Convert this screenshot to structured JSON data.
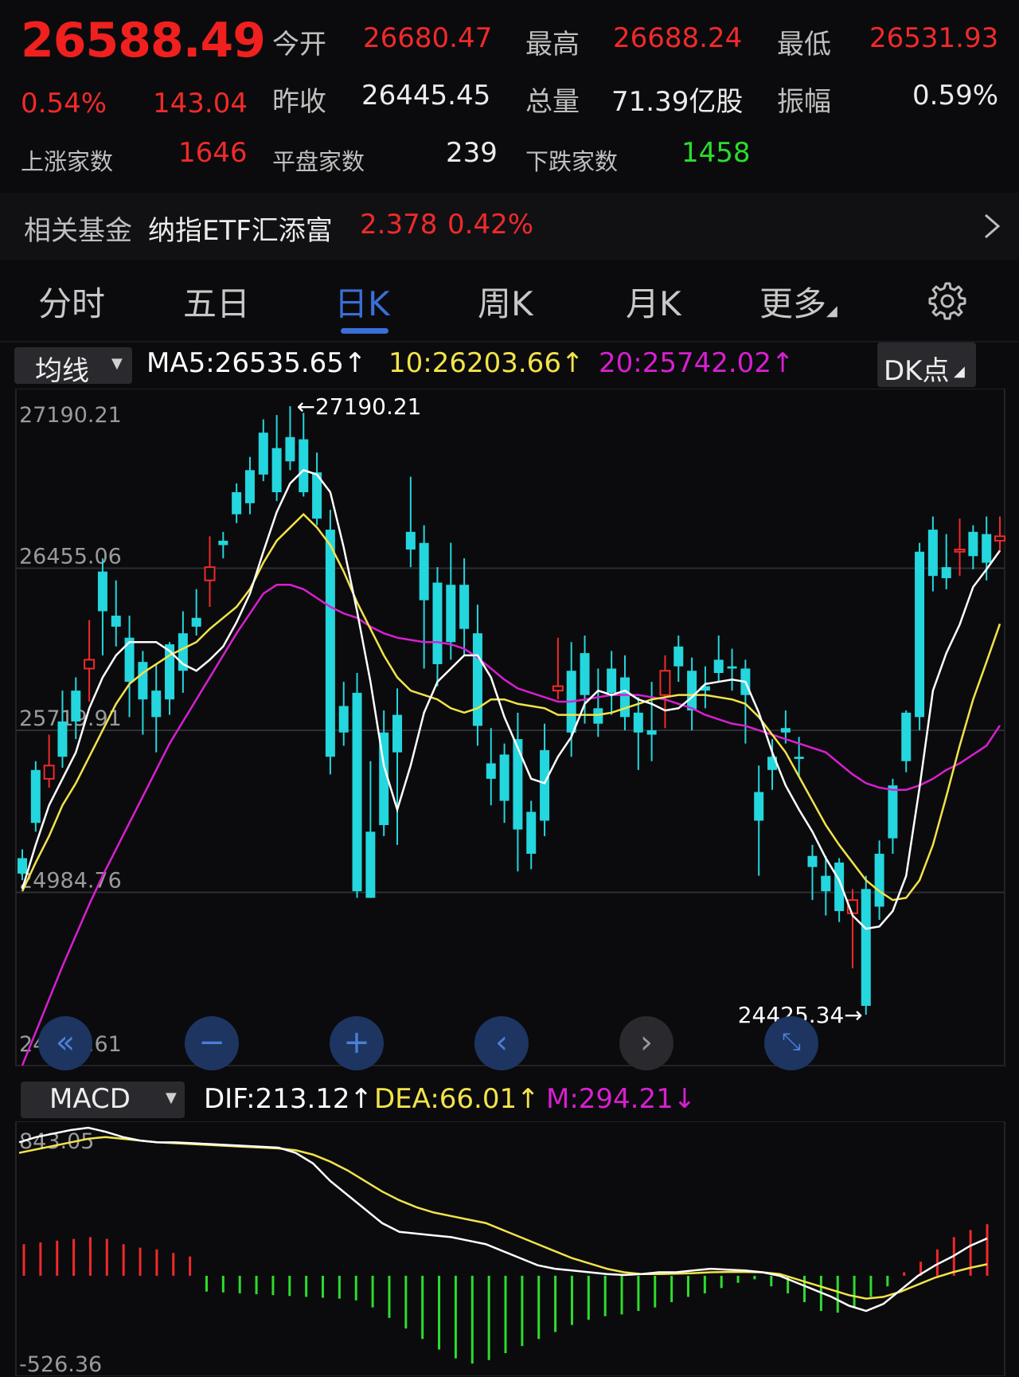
{
  "quote": {
    "price": "26588.49",
    "change_pct": "0.54%",
    "change_val": "143.04",
    "open_label": "今开",
    "open": "26680.47",
    "high_label": "最高",
    "high": "26688.24",
    "low_label": "最低",
    "low": "26531.93",
    "prev_close_label": "昨收",
    "prev_close": "26445.45",
    "volume_label": "总量",
    "volume": "71.39亿股",
    "amplitude_label": "振幅",
    "amplitude": "0.59%",
    "up_label": "上涨家数",
    "up_count": "1646",
    "flat_label": "平盘家数",
    "flat_count": "239",
    "down_label": "下跌家数",
    "down_count": "1458"
  },
  "fund": {
    "label": "相关基金",
    "name": "纳指ETF汇添富",
    "price": "2.378",
    "change": "0.42%"
  },
  "tabs": [
    "分时",
    "五日",
    "日K",
    "周K",
    "月K",
    "更多"
  ],
  "active_tab": 2,
  "indicator": {
    "select_label": "均线",
    "ma5": "MA5:26535.65↑",
    "ma10": "10:26203.66↑",
    "ma20": "20:25742.02↑",
    "dk_label": "DK点"
  },
  "macd": {
    "select_label": "MACD",
    "dif": "DIF:213.12↑",
    "dea": "DEA:66.01↑",
    "m": "M:294.21↓"
  },
  "colors": {
    "up": "#f02a2a",
    "down": "#24d6de",
    "ma5": "#ffffff",
    "ma10": "#f2e34a",
    "ma20": "#d81fd0",
    "accent": "#3a6fd8",
    "macd_pos": "#f02a2a",
    "macd_neg": "#2ddc2d"
  },
  "nav_icons": [
    "fast-back-icon",
    "zoom-out-icon",
    "zoom-in-icon",
    "prev-icon",
    "next-icon",
    "crosshair-icon"
  ],
  "chart_data": [
    {
      "type": "candlestick",
      "y_ticks": [
        "27190.21",
        "26455.06",
        "25719.91",
        "24984.76",
        "24249.61"
      ],
      "ylim": [
        24249.61,
        27190.21
      ],
      "annotations": {
        "max": "←27190.21",
        "min": "24425.34→"
      },
      "candles": [
        [
          25140,
          25070,
          25180,
          25040
        ],
        [
          25540,
          25300,
          25580,
          25260
        ],
        [
          25500,
          25560,
          25700,
          25460
        ],
        [
          25760,
          25600,
          25900,
          25550
        ],
        [
          25900,
          25760,
          25960,
          25680
        ],
        [
          26000,
          26040,
          26220,
          25850
        ],
        [
          26440,
          26260,
          26500,
          26060
        ],
        [
          26240,
          26190,
          26400,
          26100
        ],
        [
          26140,
          25940,
          26240,
          25780
        ],
        [
          26030,
          25860,
          26080,
          25700
        ],
        [
          25900,
          25780,
          26020,
          25620
        ],
        [
          26110,
          25860,
          26120,
          25790
        ],
        [
          26160,
          25990,
          26260,
          25890
        ],
        [
          26230,
          26190,
          26360,
          26150
        ],
        [
          26400,
          26460,
          26600,
          26280
        ],
        [
          26580,
          26560,
          26620,
          26500
        ],
        [
          26800,
          26700,
          26840,
          26660
        ],
        [
          26900,
          26750,
          26960,
          26700
        ],
        [
          27070,
          26880,
          27130,
          26850
        ],
        [
          27000,
          26800,
          27150,
          26760
        ],
        [
          27050,
          26940,
          27190,
          26900
        ],
        [
          27040,
          26800,
          27160,
          26780
        ],
        [
          26890,
          26680,
          26980,
          26650
        ],
        [
          26630,
          25600,
          26720,
          25520
        ],
        [
          25830,
          25710,
          25940,
          25650
        ],
        [
          25890,
          24990,
          25980,
          24960
        ],
        [
          25260,
          24960,
          25580,
          24960
        ],
        [
          25710,
          25290,
          25810,
          25240
        ],
        [
          25790,
          25620,
          25910,
          25200
        ],
        [
          26620,
          26540,
          26870,
          26460
        ],
        [
          26570,
          26310,
          26650,
          26000
        ],
        [
          26390,
          26020,
          26460,
          25920
        ],
        [
          26380,
          26120,
          26570,
          26040
        ],
        [
          26380,
          26180,
          26500,
          26060
        ],
        [
          26160,
          25740,
          26290,
          25650
        ],
        [
          25570,
          25500,
          25730,
          25380
        ],
        [
          25610,
          25400,
          25660,
          25300
        ],
        [
          25680,
          25270,
          25800,
          25080
        ],
        [
          25350,
          25160,
          25400,
          25090
        ],
        [
          25630,
          25310,
          25750,
          25240
        ],
        [
          25900,
          25920,
          26140,
          25860
        ],
        [
          25990,
          25710,
          26120,
          25600
        ],
        [
          26070,
          25880,
          26150,
          25750
        ],
        [
          25820,
          25750,
          26000,
          25690
        ],
        [
          26000,
          25890,
          26080,
          25790
        ],
        [
          25960,
          25780,
          26060,
          25720
        ],
        [
          25800,
          25710,
          25870,
          25540
        ],
        [
          25720,
          25700,
          25940,
          25580
        ],
        [
          25880,
          25990,
          26060,
          25730
        ],
        [
          26100,
          26010,
          26150,
          25940
        ],
        [
          25990,
          25810,
          26050,
          25720
        ],
        [
          25920,
          25900,
          26010,
          25820
        ],
        [
          26040,
          25980,
          26150,
          25940
        ],
        [
          26010,
          26000,
          26090,
          25900
        ],
        [
          26000,
          25880,
          26040,
          25660
        ],
        [
          25440,
          25310,
          25560,
          25060
        ],
        [
          25600,
          25540,
          25680,
          25450
        ],
        [
          25730,
          25710,
          25810,
          25660
        ],
        [
          25600,
          25590,
          25690,
          25510
        ],
        [
          25150,
          25100,
          25200,
          24950
        ],
        [
          25060,
          24990,
          25150,
          24880
        ],
        [
          25120,
          24900,
          25140,
          24850
        ],
        [
          24890,
          24950,
          25000,
          24640
        ],
        [
          25000,
          24470,
          25060,
          24430
        ],
        [
          25160,
          24920,
          25220,
          24860
        ],
        [
          25470,
          25230,
          25500,
          25160
        ],
        [
          25800,
          25580,
          25810,
          25530
        ],
        [
          26530,
          25780,
          26570,
          25720
        ],
        [
          26630,
          26420,
          26690,
          26350
        ],
        [
          26460,
          26410,
          26610,
          26360
        ],
        [
          26530,
          26540,
          26680,
          26420
        ],
        [
          26620,
          26510,
          26650,
          26450
        ],
        [
          26610,
          26480,
          26690,
          26400
        ],
        [
          26580,
          26600,
          26690,
          26530
        ]
      ],
      "ma5": [
        25000,
        25200,
        25380,
        25500,
        25620,
        25820,
        25960,
        26060,
        26120,
        26120,
        26120,
        26080,
        26020,
        25990,
        26040,
        26100,
        26210,
        26340,
        26530,
        26710,
        26840,
        26900,
        26880,
        26800,
        26550,
        26260,
        25940,
        25560,
        25360,
        25560,
        25800,
        25940,
        26000,
        26060,
        26060,
        25960,
        25780,
        25640,
        25500,
        25480,
        25600,
        25690,
        25840,
        25900,
        25880,
        25900,
        25860,
        25840,
        25810,
        25820,
        25870,
        25930,
        25940,
        25950,
        25940,
        25800,
        25620,
        25470,
        25360,
        25260,
        25140,
        25040,
        24880,
        24820,
        24830,
        24900,
        25060,
        25460,
        25900,
        26070,
        26200,
        26370,
        26450,
        26535
      ],
      "ma10": [
        24990,
        25120,
        25240,
        25380,
        25480,
        25600,
        25720,
        25840,
        25930,
        25980,
        26020,
        26060,
        26090,
        26120,
        26180,
        26230,
        26280,
        26360,
        26480,
        26580,
        26640,
        26700,
        26640,
        26560,
        26440,
        26300,
        26180,
        26060,
        25960,
        25900,
        25880,
        25860,
        25820,
        25800,
        25820,
        25860,
        25860,
        25840,
        25830,
        25820,
        25790,
        25790,
        25790,
        25790,
        25800,
        25820,
        25840,
        25860,
        25870,
        25880,
        25880,
        25880,
        25870,
        25860,
        25840,
        25780,
        25700,
        25620,
        25510,
        25400,
        25290,
        25200,
        25120,
        25040,
        24990,
        24950,
        24960,
        25040,
        25200,
        25420,
        25650,
        25860,
        26030,
        26203
      ],
      "ma20": [
        24200,
        24350,
        24500,
        24650,
        24790,
        24930,
        25060,
        25180,
        25300,
        25420,
        25540,
        25660,
        25760,
        25860,
        25960,
        26060,
        26160,
        26250,
        26340,
        26380,
        26380,
        26360,
        26320,
        26280,
        26250,
        26230,
        26190,
        26160,
        26140,
        26130,
        26120,
        26120,
        26110,
        26090,
        26050,
        26000,
        25950,
        25910,
        25890,
        25870,
        25850,
        25850,
        25860,
        25870,
        25880,
        25880,
        25880,
        25870,
        25860,
        25840,
        25820,
        25790,
        25770,
        25750,
        25740,
        25720,
        25700,
        25680,
        25660,
        25640,
        25620,
        25570,
        25520,
        25480,
        25460,
        25450,
        25450,
        25470,
        25500,
        25540,
        25570,
        25610,
        25650,
        25742
      ]
    },
    {
      "type": "macd",
      "y_ticks": [
        "843.05",
        "-526.36"
      ],
      "ylim": [
        -526.36,
        843.05
      ],
      "dif": [
        760,
        790,
        810,
        830,
        843,
        820,
        790,
        770,
        760,
        760,
        755,
        750,
        745,
        740,
        735,
        730,
        700,
        640,
        540,
        460,
        380,
        300,
        250,
        240,
        230,
        220,
        200,
        180,
        140,
        100,
        60,
        40,
        30,
        20,
        10,
        5,
        10,
        20,
        20,
        30,
        40,
        35,
        30,
        20,
        0,
        -40,
        -80,
        -120,
        -170,
        -200,
        -160,
        -80,
        0,
        60,
        110,
        170,
        213
      ],
      "dea": [
        700,
        720,
        740,
        760,
        780,
        790,
        780,
        770,
        760,
        755,
        750,
        745,
        740,
        735,
        730,
        725,
        715,
        690,
        650,
        600,
        540,
        480,
        430,
        390,
        360,
        340,
        320,
        300,
        260,
        220,
        180,
        140,
        100,
        70,
        40,
        20,
        10,
        10,
        12,
        15,
        20,
        22,
        22,
        20,
        10,
        -20,
        -50,
        -80,
        -110,
        -130,
        -120,
        -90,
        -50,
        -10,
        20,
        45,
        66
      ],
      "m": [
        180,
        190,
        200,
        210,
        220,
        210,
        180,
        160,
        150,
        130,
        110,
        -90,
        -95,
        -100,
        -105,
        -110,
        -115,
        -120,
        -125,
        -130,
        -140,
        -180,
        -240,
        -300,
        -360,
        -420,
        -470,
        -500,
        -480,
        -440,
        -400,
        -360,
        -320,
        -280,
        -250,
        -230,
        -220,
        -200,
        -180,
        -150,
        -120,
        -100,
        -70,
        -40,
        -20,
        -60,
        -100,
        -150,
        -200,
        -210,
        -180,
        -120,
        -60,
        20,
        80,
        150,
        220,
        260,
        294
      ]
    }
  ]
}
